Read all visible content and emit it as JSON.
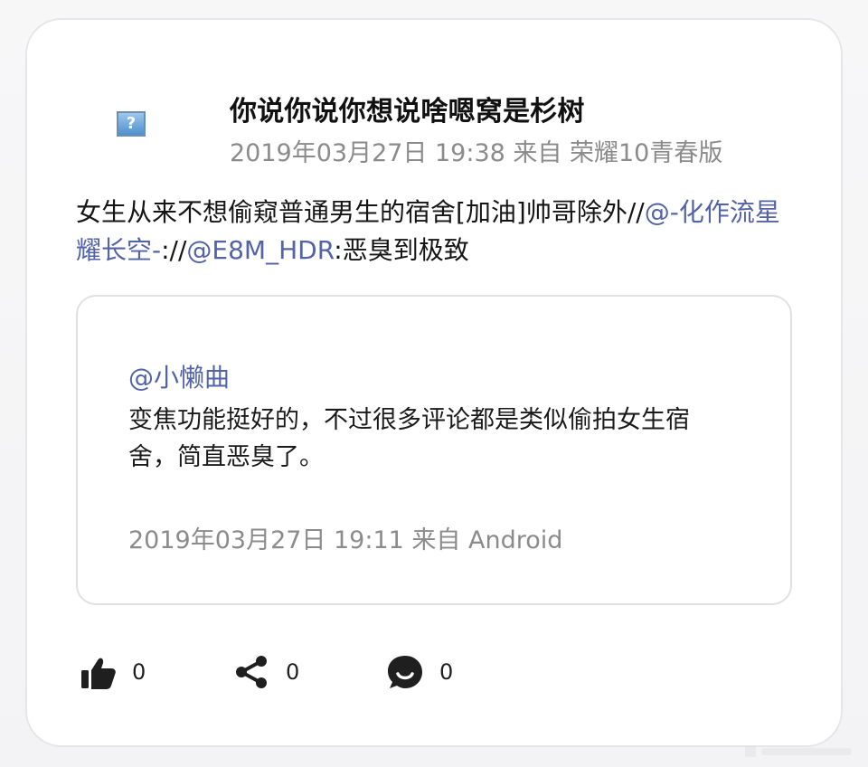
{
  "post": {
    "author": "你说你说你想说啥嗯窝是杉树",
    "meta": "2019年03月27日 19:38 来自 荣耀10青春版",
    "body_prefix": "女生从来不想偷窥普通男生的宿舍[加油]帅哥除外//",
    "mention1": "@-化作流星耀长空-",
    "middle": "://",
    "mention2": "@E8M_HDR",
    "body_suffix": ":恶臭到极致"
  },
  "quote": {
    "author": "@小懒曲",
    "text": "变焦功能挺好的，不过很多评论都是类似偷拍女生宿舍，简直恶臭了。",
    "meta": "2019年03月27日 19:11 来自 Android"
  },
  "actions": {
    "like_count": "0",
    "share_count": "0",
    "comment_count": "0"
  },
  "icons": {
    "avatar": "broken-image-icon",
    "like": "thumb-up-icon",
    "share": "share-icon",
    "comment": "comment-icon"
  },
  "colors": {
    "mention": "#5363a8",
    "meta": "#8b8b8b",
    "text": "#151515",
    "border": "#e1e1e5"
  }
}
